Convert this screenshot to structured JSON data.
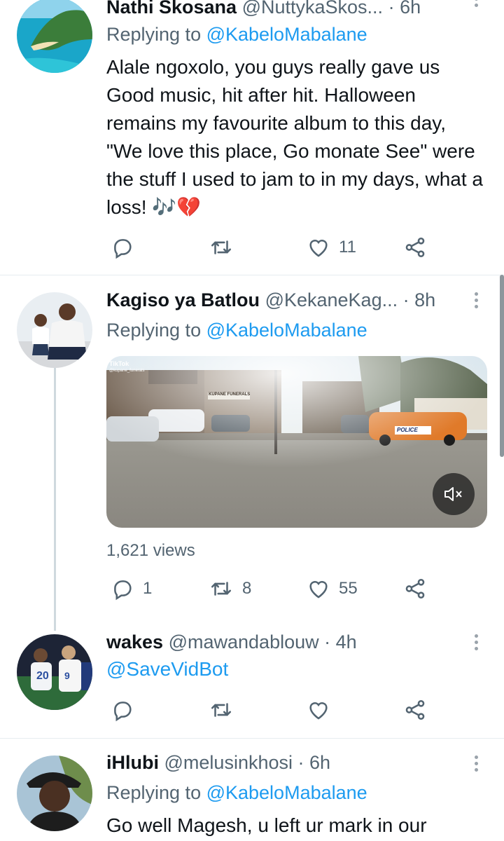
{
  "tweets": [
    {
      "name": "Nathi Skosana",
      "handle": "@NuttykaSkos...",
      "time": "· 6h",
      "replying_prefix": "Replying to ",
      "replying_to": "@KabeloMabalane",
      "text": "Alale ngoxolo, you guys really gave us Good music, hit after hit. Halloween remains my favourite album to this day, \"We love this place, Go monate See\" were the stuff I used to jam to in my days, what a loss! 🎶💔",
      "reply_count": "",
      "retweet_count": "",
      "like_count": "11"
    },
    {
      "name": "Kagiso ya Batlou",
      "handle": "@KekaneKag...",
      "time": "· 8h",
      "replying_prefix": "Replying to ",
      "replying_to": "@KabeloMabalane",
      "media": {
        "watermark": "TikTok",
        "watermark_user": "@kupane_funerals",
        "sign_text": "KUPANE FUNERALS",
        "car_text": "POLICE"
      },
      "views": "1,621 views",
      "reply_count": "1",
      "retweet_count": "8",
      "like_count": "55"
    },
    {
      "name": "wakes",
      "handle": "@mawandablouw",
      "time": "· 4h",
      "text": "@SaveVidBot",
      "reply_count": "",
      "retweet_count": "",
      "like_count": ""
    },
    {
      "name": "iHlubi",
      "handle": "@melusinkhosi",
      "time": "· 6h",
      "replying_prefix": "Replying to ",
      "replying_to": "@KabeloMabalane",
      "text": "Go well Magesh, u left ur mark in our"
    }
  ],
  "colors": {
    "accent": "#1d9bf0",
    "muted": "#536471",
    "divider": "#e6ecf0"
  }
}
